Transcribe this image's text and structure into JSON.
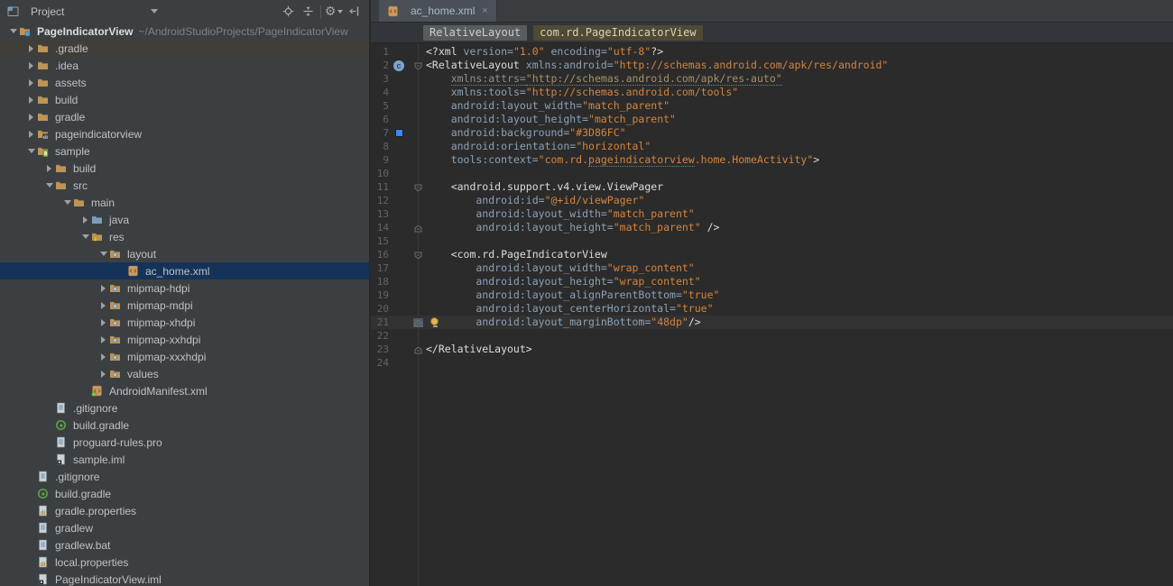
{
  "colors": {
    "panel_bg": "#3C3F41",
    "editor_bg": "#2B2B2B",
    "selection_bg": "#153358",
    "current_line_bg": "#323232",
    "tag_color": "#DCDCDC",
    "attribute_color": "#8CA1B6",
    "value_color": "#D6843C",
    "background_attr_chip": "#3D86FC"
  },
  "project_panel": {
    "title": "Project",
    "toolbar_icons": [
      "locate",
      "collapse-all",
      "settings",
      "hide-panel"
    ],
    "tree": [
      {
        "label": "PageIndicatorView",
        "path": "~/AndroidStudioProjects/PageIndicatorView",
        "level": 0,
        "icon": "project",
        "arrow": "down",
        "root": true
      },
      {
        "label": ".gradle",
        "level": 1,
        "icon": "folder",
        "arrow": "right",
        "hovered": true
      },
      {
        "label": ".idea",
        "level": 1,
        "icon": "folder",
        "arrow": "right"
      },
      {
        "label": "assets",
        "level": 1,
        "icon": "folder",
        "arrow": "right"
      },
      {
        "label": "build",
        "level": 1,
        "icon": "folder",
        "arrow": "right"
      },
      {
        "label": "gradle",
        "level": 1,
        "icon": "folder",
        "arrow": "right"
      },
      {
        "label": "pageindicatorview",
        "level": 1,
        "icon": "module-lib",
        "arrow": "right"
      },
      {
        "label": "sample",
        "level": 1,
        "icon": "module-android",
        "arrow": "down"
      },
      {
        "label": "build",
        "level": 2,
        "icon": "folder",
        "arrow": "right"
      },
      {
        "label": "src",
        "level": 2,
        "icon": "folder",
        "arrow": "down"
      },
      {
        "label": "main",
        "level": 3,
        "icon": "folder",
        "arrow": "down"
      },
      {
        "label": "java",
        "level": 4,
        "icon": "folder-java",
        "arrow": "right"
      },
      {
        "label": "res",
        "level": 4,
        "icon": "folder-res",
        "arrow": "down"
      },
      {
        "label": "layout",
        "level": 5,
        "icon": "folder-resitem",
        "arrow": "down"
      },
      {
        "label": "ac_home.xml",
        "level": 6,
        "icon": "xml",
        "selected": true
      },
      {
        "label": "mipmap-hdpi",
        "level": 5,
        "icon": "folder-resitem",
        "arrow": "right"
      },
      {
        "label": "mipmap-mdpi",
        "level": 5,
        "icon": "folder-resitem",
        "arrow": "right"
      },
      {
        "label": "mipmap-xhdpi",
        "level": 5,
        "icon": "folder-resitem",
        "arrow": "right"
      },
      {
        "label": "mipmap-xxhdpi",
        "level": 5,
        "icon": "folder-resitem",
        "arrow": "right"
      },
      {
        "label": "mipmap-xxxhdpi",
        "level": 5,
        "icon": "folder-resitem",
        "arrow": "right"
      },
      {
        "label": "values",
        "level": 5,
        "icon": "folder-resitem",
        "arrow": "right"
      },
      {
        "label": "AndroidManifest.xml",
        "level": 4,
        "icon": "manifest"
      },
      {
        "label": ".gitignore",
        "level": 2,
        "icon": "text"
      },
      {
        "label": "build.gradle",
        "level": 2,
        "icon": "gradle"
      },
      {
        "label": "proguard-rules.pro",
        "level": 2,
        "icon": "text"
      },
      {
        "label": "sample.iml",
        "level": 2,
        "icon": "iml"
      },
      {
        "label": ".gitignore",
        "level": 1,
        "icon": "text"
      },
      {
        "label": "build.gradle",
        "level": 1,
        "icon": "gradle"
      },
      {
        "label": "gradle.properties",
        "level": 1,
        "icon": "properties"
      },
      {
        "label": "gradlew",
        "level": 1,
        "icon": "text"
      },
      {
        "label": "gradlew.bat",
        "level": 1,
        "icon": "text"
      },
      {
        "label": "local.properties",
        "level": 1,
        "icon": "properties"
      },
      {
        "label": "PageIndicatorView.iml",
        "level": 1,
        "icon": "iml"
      }
    ]
  },
  "editor": {
    "tab": {
      "label": "ac_home.xml",
      "icon": "xml",
      "close": "×"
    },
    "breadcrumbs": [
      {
        "label": "RelativeLayout",
        "current": false
      },
      {
        "label": "com.rd.PageIndicatorView",
        "current": true
      }
    ],
    "code": {
      "lines": [
        {
          "n": 1,
          "seg": [
            [
              "t",
              "<?xml "
            ],
            [
              "a",
              "version="
            ],
            [
              "v",
              "\"1.0\""
            ],
            [
              "t",
              " "
            ],
            [
              "a",
              "encoding="
            ],
            [
              "v",
              "\"utf-8\""
            ],
            [
              "t",
              "?>"
            ]
          ]
        },
        {
          "n": 2,
          "gutter": "c",
          "fold": "down",
          "seg": [
            [
              "t",
              "<RelativeLayout "
            ],
            [
              "a",
              "xmlns:android="
            ],
            [
              "v",
              "\"http://schemas.android.com/apk/res/android\""
            ]
          ]
        },
        {
          "n": 3,
          "seg": [
            [
              "t",
              "    "
            ],
            [
              "ga",
              "xmlns:attrs="
            ],
            [
              "gv",
              "\"http://schemas.android.com/apk/res-auto\""
            ]
          ]
        },
        {
          "n": 4,
          "seg": [
            [
              "t",
              "    "
            ],
            [
              "a",
              "xmlns:tools="
            ],
            [
              "v",
              "\"http://schemas.android.com/tools\""
            ]
          ]
        },
        {
          "n": 5,
          "seg": [
            [
              "t",
              "    "
            ],
            [
              "a",
              "android:layout_width="
            ],
            [
              "v",
              "\"match_parent\""
            ]
          ]
        },
        {
          "n": 6,
          "seg": [
            [
              "t",
              "    "
            ],
            [
              "a",
              "android:layout_height="
            ],
            [
              "v",
              "\"match_parent\""
            ]
          ]
        },
        {
          "n": 7,
          "gutter": "color",
          "seg": [
            [
              "t",
              "    "
            ],
            [
              "a",
              "android:background="
            ],
            [
              "v",
              "\"#3D86FC\""
            ]
          ]
        },
        {
          "n": 8,
          "seg": [
            [
              "t",
              "    "
            ],
            [
              "a",
              "android:orientation="
            ],
            [
              "v",
              "\"horizontal\""
            ]
          ]
        },
        {
          "n": 9,
          "seg": [
            [
              "t",
              "    "
            ],
            [
              "a",
              "tools:context="
            ],
            [
              "v",
              "\"com.rd."
            ],
            [
              "tv",
              "pageindicatorview"
            ],
            [
              "v",
              ".home.HomeActivity\""
            ],
            [
              "t",
              ">"
            ]
          ]
        },
        {
          "n": 10,
          "seg": []
        },
        {
          "n": 11,
          "fold": "down",
          "seg": [
            [
              "t",
              "    <android.support.v4.view.ViewPager"
            ]
          ]
        },
        {
          "n": 12,
          "seg": [
            [
              "t",
              "        "
            ],
            [
              "a",
              "android:id="
            ],
            [
              "v",
              "\"@+id/viewPager\""
            ]
          ]
        },
        {
          "n": 13,
          "seg": [
            [
              "t",
              "        "
            ],
            [
              "a",
              "android:layout_width="
            ],
            [
              "v",
              "\"match_parent\""
            ]
          ]
        },
        {
          "n": 14,
          "fold": "up",
          "seg": [
            [
              "t",
              "        "
            ],
            [
              "a",
              "android:layout_height="
            ],
            [
              "v",
              "\"match_parent\""
            ],
            [
              "t",
              " />"
            ]
          ]
        },
        {
          "n": 15,
          "seg": []
        },
        {
          "n": 16,
          "fold": "down",
          "seg": [
            [
              "t",
              "    <com.rd.PageIndicatorView"
            ]
          ]
        },
        {
          "n": 17,
          "seg": [
            [
              "t",
              "        "
            ],
            [
              "a",
              "android:layout_width="
            ],
            [
              "v",
              "\"wrap_content\""
            ]
          ]
        },
        {
          "n": 18,
          "seg": [
            [
              "t",
              "        "
            ],
            [
              "a",
              "android:layout_height="
            ],
            [
              "v",
              "\"wrap_content\""
            ]
          ]
        },
        {
          "n": 19,
          "seg": [
            [
              "t",
              "        "
            ],
            [
              "a",
              "android:layout_alignParentBottom="
            ],
            [
              "v",
              "\"true\""
            ]
          ]
        },
        {
          "n": 20,
          "seg": [
            [
              "t",
              "        "
            ],
            [
              "a",
              "android:layout_centerHorizontal="
            ],
            [
              "v",
              "\"true\""
            ]
          ]
        },
        {
          "n": 21,
          "fold": "up",
          "current": true,
          "bulb": true,
          "seg": [
            [
              "t",
              "        "
            ],
            [
              "a",
              "android:layout_marginBottom="
            ],
            [
              "v",
              "\"48dp\""
            ],
            [
              "t",
              "/>"
            ]
          ]
        },
        {
          "n": 22,
          "seg": []
        },
        {
          "n": 23,
          "fold": "up",
          "seg": [
            [
              "t",
              "</RelativeLayout>"
            ]
          ]
        },
        {
          "n": 24,
          "seg": []
        }
      ]
    }
  }
}
